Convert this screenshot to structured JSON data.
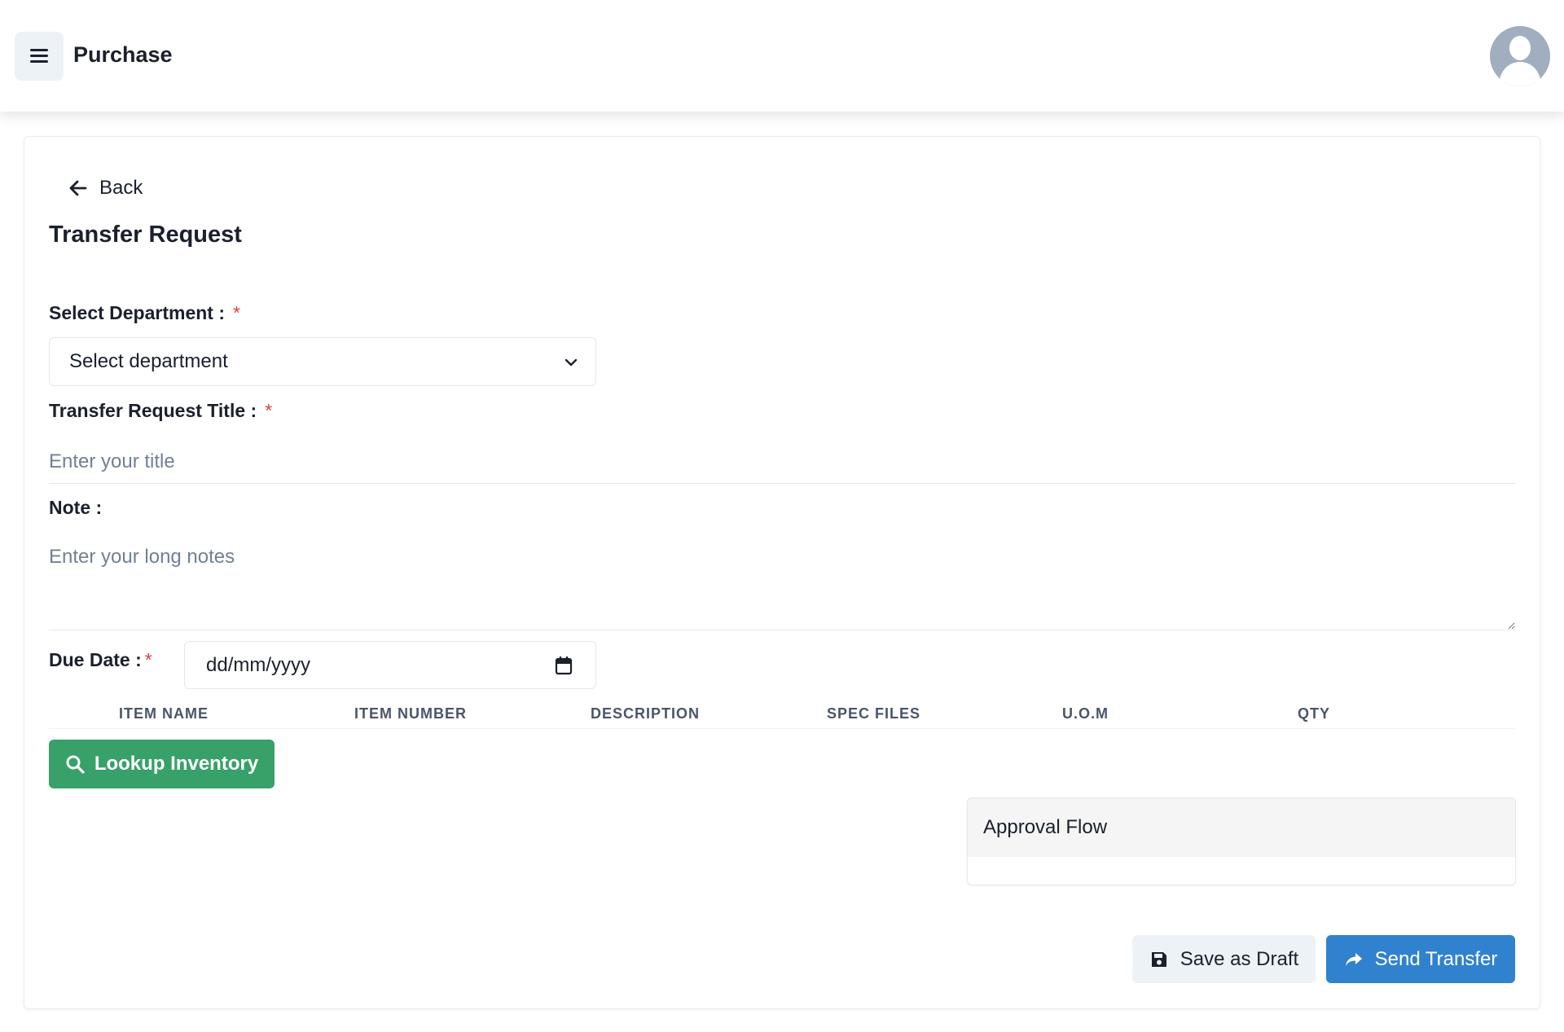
{
  "header": {
    "title": "Purchase",
    "menu_icon": "hamburger-menu-icon",
    "avatar_icon": "user-avatar-icon"
  },
  "form": {
    "back_label": "Back",
    "title": "Transfer Request",
    "department": {
      "label": "Select Department :",
      "required_mark": "*",
      "selected": "Select department"
    },
    "request_title": {
      "label": "Transfer Request Title :",
      "required_mark": "*",
      "placeholder": "Enter your title",
      "value": ""
    },
    "note": {
      "label": "Note :",
      "placeholder": "Enter your long notes",
      "value": ""
    },
    "due_date": {
      "label": "Due Date :",
      "required_mark": "*",
      "value": "dd/mm/yyyy"
    }
  },
  "table": {
    "columns": [
      "ITEM NAME",
      "ITEM NUMBER",
      "DESCRIPTION",
      "SPEC FILES",
      "U.O.M",
      "QTY"
    ]
  },
  "actions": {
    "lookup_label": "Lookup Inventory",
    "save_draft_label": "Save as Draft",
    "send_label": "Send Transfer"
  },
  "approval": {
    "title": "Approval Flow"
  },
  "colors": {
    "accent_green": "#38a169",
    "accent_blue": "#3182ce",
    "required_red": "#e53e3e"
  }
}
